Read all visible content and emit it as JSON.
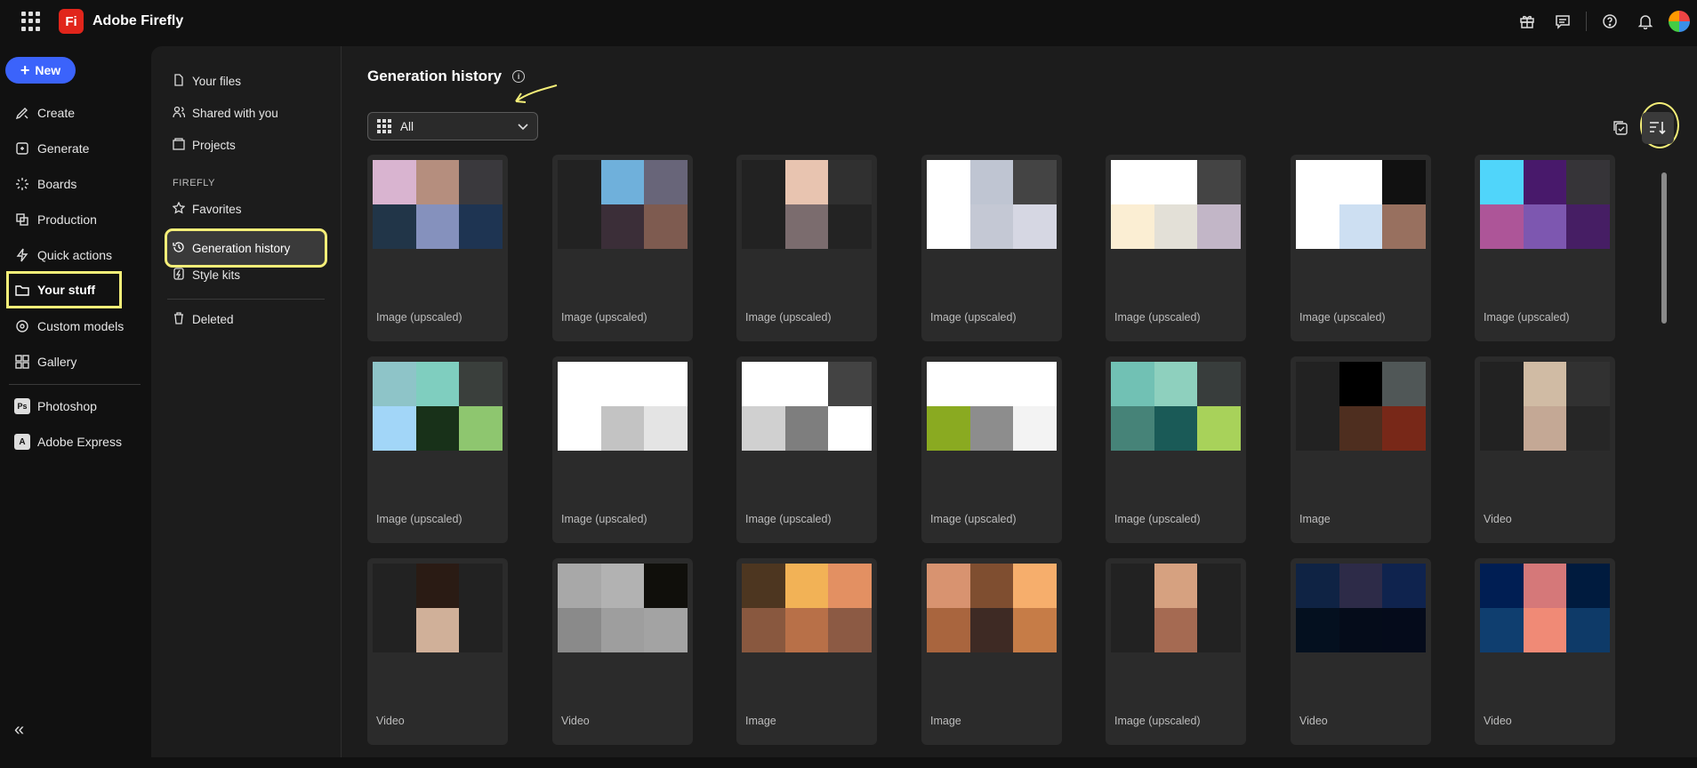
{
  "app": {
    "name": "Adobe Firefly",
    "logo_text": "Fi"
  },
  "header_icons": [
    "gift-icon",
    "feedback-icon",
    "help-icon",
    "bell-icon",
    "avatar"
  ],
  "rail": {
    "new_label": "New",
    "items": [
      "Create",
      "Generate",
      "Boards",
      "Production",
      "Quick actions",
      "Your stuff",
      "Custom models",
      "Gallery"
    ],
    "apps": [
      "Photoshop",
      "Adobe Express"
    ],
    "collapse_glyph": "«"
  },
  "subnav": {
    "items": [
      "Your files",
      "Shared with you",
      "Projects"
    ],
    "section": "FIREFLY",
    "firefly_items": [
      "Favorites",
      "Generation history",
      "Style kits"
    ],
    "deleted": "Deleted"
  },
  "main": {
    "title": "Generation history",
    "info_glyph": "i",
    "filter_value": "All"
  },
  "cards": [
    {
      "label": "Image (upscaled)",
      "colors": [
        "#d9b4d0",
        "#b58e7e",
        "#3a393d",
        "#213548",
        "#8591bd",
        "#1e3452"
      ]
    },
    {
      "label": "Image (upscaled)",
      "colors": [
        "#222222",
        "#6fb0db",
        "#686579",
        "#222222",
        "#3b2e38",
        "#7e5b50"
      ]
    },
    {
      "label": "Image (upscaled)",
      "colors": [
        "#222222",
        "#e8c4b0",
        "#303030",
        "#222222",
        "#7b6c6e",
        "#232323"
      ]
    },
    {
      "label": "Image (upscaled)",
      "colors": [
        "#ffffff",
        "#bfc5d2",
        "#444444",
        "#ffffff",
        "#c4c8d4",
        "#d6d7e3"
      ]
    },
    {
      "label": "Image (upscaled)",
      "colors": [
        "#ffffff",
        "#ffffff",
        "#444444",
        "#fbeed3",
        "#e3e0d7",
        "#c2b6c7"
      ]
    },
    {
      "label": "Image (upscaled)",
      "colors": [
        "#ffffff",
        "#ffffff",
        "#111111",
        "#ffffff",
        "#cddff2",
        "#98705f"
      ]
    },
    {
      "label": "Image (upscaled)",
      "colors": [
        "#50d5fa",
        "#48196b",
        "#363438",
        "#ad5598",
        "#7d57b0",
        "#461e64"
      ]
    },
    {
      "label": "Image (upscaled)",
      "colors": [
        "#8ec4c8",
        "#7fcebf",
        "#3a3f3c",
        "#a2d6f8",
        "#183119",
        "#8ec66f"
      ]
    },
    {
      "label": "Image (upscaled)",
      "colors": [
        "#ffffff",
        "#ffffff",
        "#ffffff",
        "#ffffff",
        "#c3c3c3",
        "#e4e4e4"
      ]
    },
    {
      "label": "Image (upscaled)",
      "colors": [
        "#ffffff",
        "#ffffff",
        "#434343",
        "#d0d0d0",
        "#7e7e7e",
        "#ffffff"
      ]
    },
    {
      "label": "Image (upscaled)",
      "colors": [
        "#ffffff",
        "#ffffff",
        "#ffffff",
        "#8aaa21",
        "#8d8d8d",
        "#f3f3f3"
      ]
    },
    {
      "label": "Image (upscaled)",
      "colors": [
        "#71c1b4",
        "#8ed0be",
        "#383d3c",
        "#468378",
        "#1a5a57",
        "#a8d25a"
      ]
    },
    {
      "label": "Image",
      "colors": [
        "#222222",
        "#000000",
        "#505757",
        "#222222",
        "#4e2e1f",
        "#782818"
      ]
    },
    {
      "label": "Video",
      "colors": [
        "#222222",
        "#d0bba4",
        "#313131",
        "#222222",
        "#c4a895",
        "#262626"
      ]
    },
    {
      "label": "Video",
      "colors": [
        "#222222",
        "#2a1b14",
        "#222222",
        "#222222",
        "#d0b099",
        "#222222"
      ]
    },
    {
      "label": "Video",
      "colors": [
        "#a8a8a8",
        "#b2b2b2",
        "#100f0b",
        "#8a8a8a",
        "#9e9e9e",
        "#a3a3a3"
      ]
    },
    {
      "label": "Image",
      "colors": [
        "#4d3620",
        "#f2b256",
        "#e39062",
        "#89583f",
        "#b87048",
        "#8c5a44"
      ]
    },
    {
      "label": "Image",
      "colors": [
        "#d89370",
        "#7f4e30",
        "#f6ae6c",
        "#a9653e",
        "#3e2a24",
        "#c67c47"
      ]
    },
    {
      "label": "Image (upscaled)",
      "colors": [
        "#222222",
        "#d6a180",
        "#222222",
        "#222222",
        "#a56a52",
        "#222222"
      ]
    },
    {
      "label": "Video",
      "colors": [
        "#0f2344",
        "#2d2b48",
        "#0f234e",
        "#04101f",
        "#050c1a",
        "#050b1b"
      ]
    },
    {
      "label": "Video",
      "colors": [
        "#001e53",
        "#d57879",
        "#001b3e",
        "#0f3e6f",
        "#f08a76",
        "#0e3a68"
      ]
    }
  ]
}
